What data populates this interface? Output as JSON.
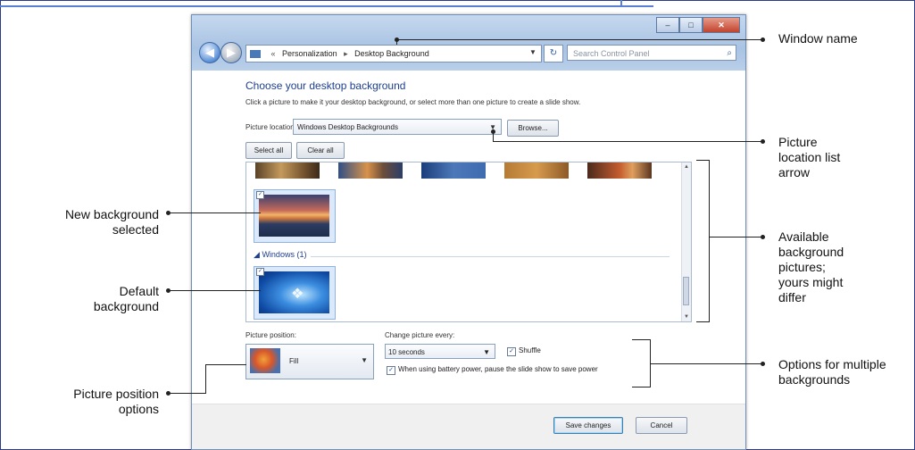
{
  "window": {
    "address": {
      "part1": "Personalization",
      "separator": "▸",
      "part2": "Desktop Background"
    },
    "search_placeholder": "Search Control Panel",
    "caption": {
      "minimize": "–",
      "maximize": "□",
      "close": "✕"
    }
  },
  "content": {
    "heading": "Choose your desktop background",
    "description": "Click a picture to make it your desktop background, or select more than one picture to create a slide show.",
    "picture_location_label": "Picture location:",
    "picture_location_value": "Windows Desktop Backgrounds",
    "browse_label": "Browse...",
    "select_all_label": "Select all",
    "clear_all_label": "Clear all",
    "group_label": "Windows (1)",
    "picture_position_label": "Picture position:",
    "picture_position_value": "Fill",
    "change_picture_label": "Change picture every:",
    "change_picture_value": "10 seconds",
    "shuffle_label": "Shuffle",
    "shuffle_checked": true,
    "battery_label": "When using battery power, pause the slide show to save power",
    "battery_checked": true,
    "save_label": "Save changes",
    "cancel_label": "Cancel"
  },
  "callouts": {
    "window_name": "Window name",
    "picture_location_arrow": "Picture\nlocation list\narrow",
    "available_pictures": "Available\nbackground\npictures;\nyours might\ndiffer",
    "options_multiple": "Options for multiple\nbackgrounds",
    "new_background": "New background\nselected",
    "default_background": "Default\nbackground",
    "position_options": "Picture position\noptions"
  }
}
